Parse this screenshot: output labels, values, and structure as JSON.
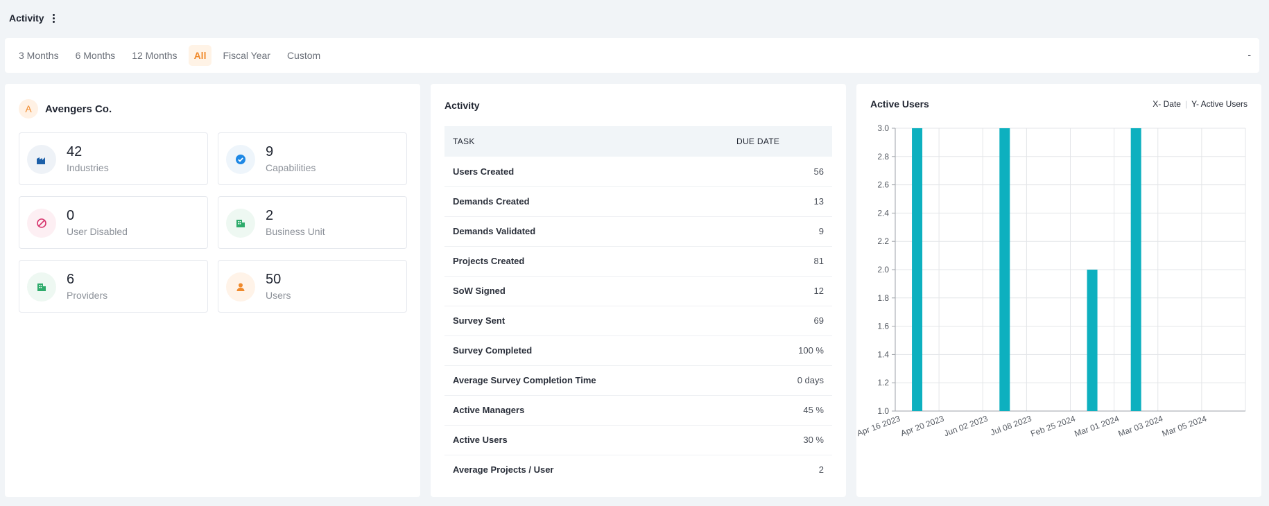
{
  "header": {
    "title": "Activity"
  },
  "filters": {
    "items": [
      "3 Months",
      "6 Months",
      "12 Months",
      "All",
      "Fiscal Year",
      "Custom"
    ],
    "active": "All",
    "right_text": "-"
  },
  "company": {
    "avatar_letter": "A",
    "name": "Avengers Co.",
    "stats": [
      {
        "value": "42",
        "label": "Industries",
        "icon": "industry-icon",
        "color": "#1c5fa8",
        "bg": "#eef2f7"
      },
      {
        "value": "9",
        "label": "Capabilities",
        "icon": "check-badge-icon",
        "color": "#1e88e5",
        "bg": "#eef5fb"
      },
      {
        "value": "0",
        "label": "User Disabled",
        "icon": "disabled-icon",
        "color": "#d6336c",
        "bg": "#fdeff3"
      },
      {
        "value": "2",
        "label": "Business Unit",
        "icon": "building-icon",
        "color": "#2eab6b",
        "bg": "#eef8f2"
      },
      {
        "value": "6",
        "label": "Providers",
        "icon": "building-icon",
        "color": "#2eab6b",
        "bg": "#eef8f2"
      },
      {
        "value": "50",
        "label": "Users",
        "icon": "user-icon",
        "color": "#f08a2c",
        "bg": "#fff3e8"
      }
    ]
  },
  "activity": {
    "title": "Activity",
    "columns": [
      "TASK",
      "DUE DATE"
    ],
    "rows": [
      {
        "task": "Users Created",
        "value": "56"
      },
      {
        "task": "Demands Created",
        "value": "13"
      },
      {
        "task": "Demands Validated",
        "value": "9"
      },
      {
        "task": "Projects Created",
        "value": "81"
      },
      {
        "task": "SoW Signed",
        "value": "12"
      },
      {
        "task": "Survey Sent",
        "value": "69"
      },
      {
        "task": "Survey Completed",
        "value": "100 %"
      },
      {
        "task": "Average Survey Completion Time",
        "value": "0 days"
      },
      {
        "task": "Active Managers",
        "value": "45 %"
      },
      {
        "task": "Active Users",
        "value": "30 %"
      },
      {
        "task": "Average Projects / User",
        "value": "2"
      }
    ]
  },
  "chart": {
    "title": "Active Users",
    "legend_x": "X- Date",
    "legend_y": "Y- Active Users",
    "bar_color": "#0db0bf",
    "chart_data": {
      "type": "bar",
      "categories": [
        "Apr 16 2023",
        "Apr 20 2023",
        "Jun 02 2023",
        "Jul 08 2023",
        "Feb 25 2024",
        "Mar 01 2024",
        "Mar 03 2024",
        "Mar 05 2024"
      ],
      "values": [
        3,
        null,
        3,
        null,
        2,
        3,
        null,
        null
      ],
      "ylim": [
        1.0,
        3.0
      ],
      "yticks": [
        "1.0",
        "1.2",
        "1.4",
        "1.6",
        "1.8",
        "2.0",
        "2.2",
        "2.4",
        "2.6",
        "2.8",
        "3.0"
      ],
      "grid": true
    }
  }
}
